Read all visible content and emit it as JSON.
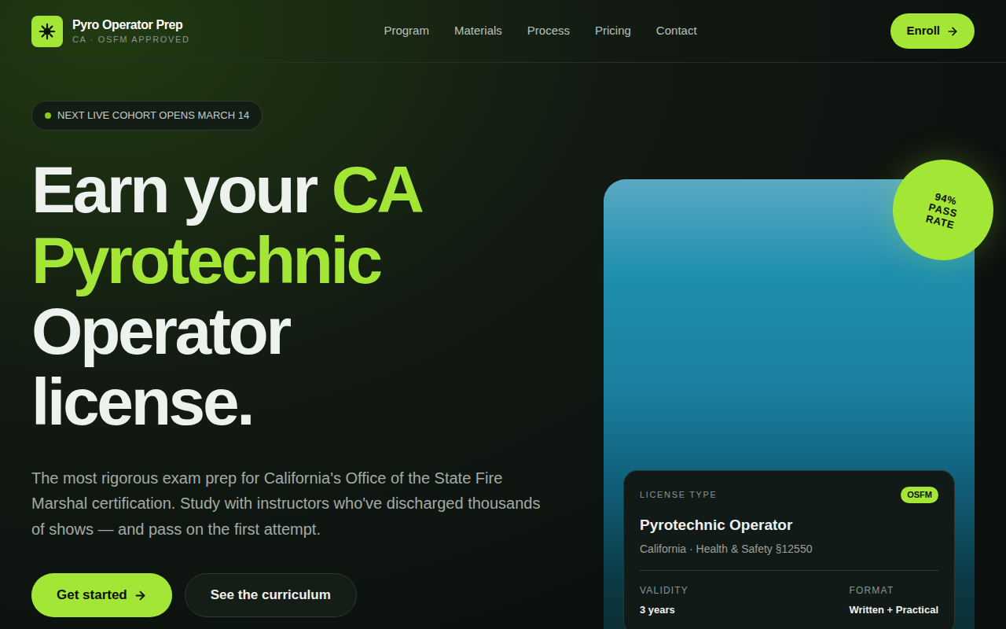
{
  "brand": {
    "name": "Pyro Operator Prep",
    "tagline": "CA · OSFM APPROVED"
  },
  "nav": {
    "links": [
      "Program",
      "Materials",
      "Process",
      "Pricing",
      "Contact"
    ],
    "cta": "Enroll"
  },
  "hero": {
    "badge": "NEXT LIVE COHORT OPENS MARCH 14",
    "headline": [
      [
        {
          "text": "Earn your ",
          "accent": false
        },
        {
          "text": "CA",
          "accent": true
        }
      ],
      [
        {
          "text": "Pyrotechnic",
          "accent": true
        }
      ],
      [
        {
          "text": "Operator",
          "accent": false
        }
      ],
      [
        {
          "text": "license.",
          "accent": false
        }
      ]
    ],
    "description": "The most rigorous exam prep for California's Office of the State Fire Marshal certification. Study with instructors who've discharged thousands of shows — and pass on the first attempt.",
    "buttons": [
      {
        "label": "Get started",
        "kind": "primary"
      },
      {
        "label": "See the curriculum",
        "kind": "secondary"
      }
    ]
  },
  "image_card": {
    "pass_badge": [
      "94%",
      "PASS",
      "RATE"
    ],
    "license": {
      "label": "LICENSE TYPE",
      "tag": "OSFM",
      "title": "Pyrotechnic Operator",
      "subtitle": "California · Health & Safety §12550",
      "facts": [
        {
          "label": "VALIDITY",
          "value": "3 years"
        },
        {
          "label": "FORMAT",
          "value": "Written + Practical"
        }
      ]
    }
  }
}
